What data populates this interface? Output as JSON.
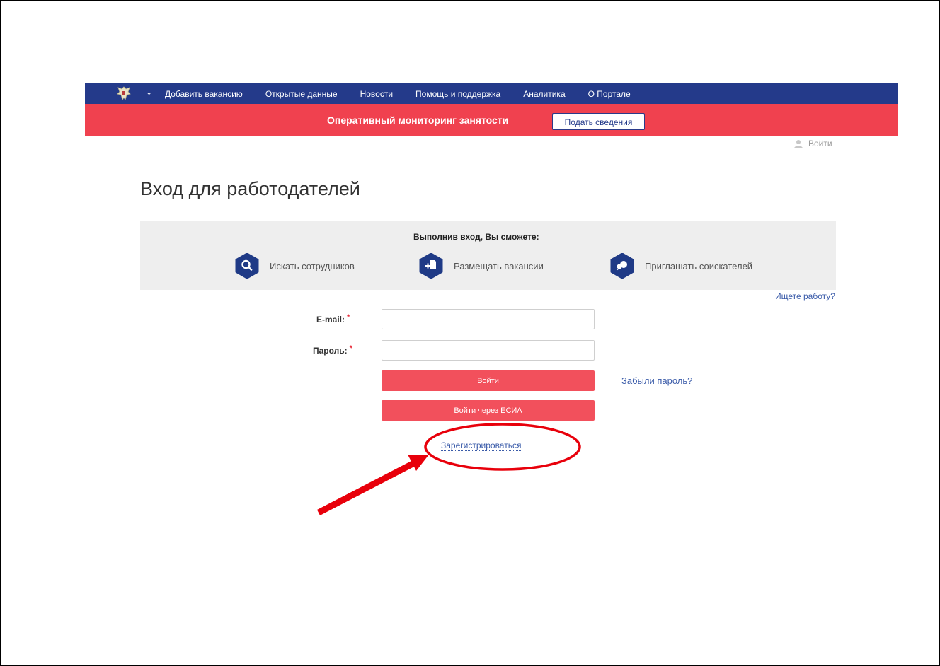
{
  "nav": {
    "items": [
      {
        "label": "Добавить вакансию"
      },
      {
        "label": "Открытые данные"
      },
      {
        "label": "Новости"
      },
      {
        "label": "Помощь и поддержка"
      },
      {
        "label": "Аналитика"
      },
      {
        "label": "О Портале"
      }
    ],
    "chevron": "⌄",
    "emblem_icon": "coat-of-arms-icon"
  },
  "banner": {
    "title": "Оперативный мониторинг занятости",
    "button_label": "Подать сведения"
  },
  "header": {
    "login_label": "Войти",
    "login_icon": "user-icon"
  },
  "page": {
    "title": "Вход для работодателей"
  },
  "benefits": {
    "title": "Выполнив вход, Вы сможете:",
    "items": [
      {
        "label": "Искать сотрудников",
        "icon": "search-icon"
      },
      {
        "label": "Размещать вакансии",
        "icon": "add-document-icon"
      },
      {
        "label": "Приглашать соискателей",
        "icon": "chat-bubble-icon"
      }
    ]
  },
  "links": {
    "job_seeker": "Ищете работу?",
    "forgot_password": "Забыли пароль?",
    "register": "Зарегистрироваться"
  },
  "form": {
    "email_label": "E-mail:",
    "password_label": "Пароль:",
    "required_mark": "*",
    "email_value": "",
    "password_value": "",
    "login_button": "Войти",
    "esia_button": "Войти через ЕСИА"
  },
  "colors": {
    "nav_bg": "#243a8a",
    "banner_bg": "#f0414f",
    "button_red": "#f2505c",
    "link_blue": "#3a5ba9",
    "annotation_red": "#e8000b"
  }
}
